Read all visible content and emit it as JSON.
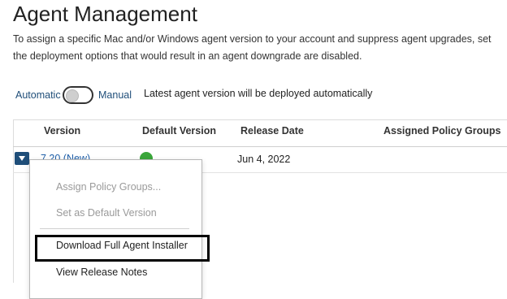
{
  "page": {
    "title": "Agent Management",
    "description": "To assign a specific Mac and/or Windows agent version to your account and suppress agent upgrades, set the deployment options that would result in an agent downgrade are disabled."
  },
  "deployment_mode": {
    "automatic_label": "Automatic",
    "manual_label": "Manual",
    "selected": "Automatic",
    "status_text": "Latest agent version will be deployed automatically"
  },
  "table": {
    "columns": [
      "Version",
      "Default Version",
      "Release Date",
      "Assigned Policy Groups"
    ],
    "rows": [
      {
        "version": "7.20 (New)",
        "is_default": true,
        "release_date": "Jun 4, 2022",
        "assigned_policy_groups": ""
      }
    ]
  },
  "row_menu": {
    "items": [
      {
        "label": "Assign Policy Groups...",
        "enabled": false
      },
      {
        "label": "Set as Default Version",
        "enabled": false
      },
      {
        "label": "Download Full Agent Installer",
        "enabled": true,
        "highlighted": true
      },
      {
        "label": "View Release Notes",
        "enabled": true
      }
    ]
  },
  "colors": {
    "accent": "#1f4e79",
    "link": "#1f5fa8",
    "default_check": "#3aa63a",
    "disabled_text": "#9a9a9a"
  },
  "icons": {
    "row_toggle": "chevron-down-icon",
    "default_indicator": "check-circle-icon"
  }
}
